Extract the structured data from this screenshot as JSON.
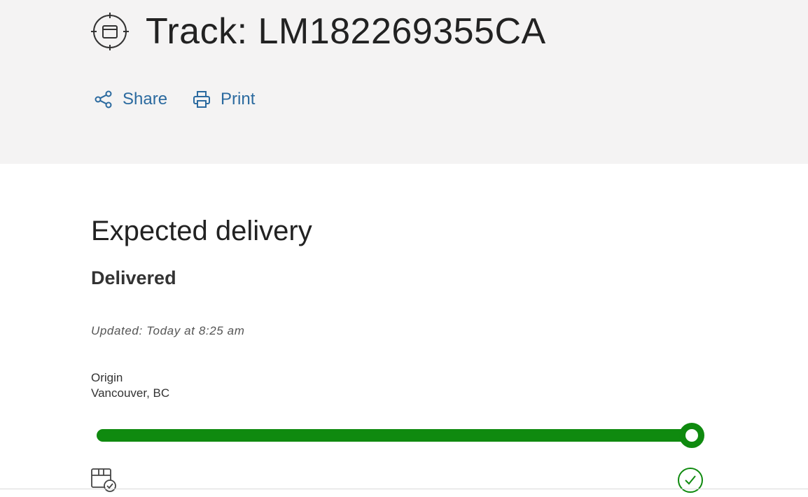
{
  "header": {
    "title": "Track: LM182269355CA",
    "title_icon": "parcel-target-icon",
    "actions": [
      {
        "label": "Share",
        "icon": "share-icon"
      },
      {
        "label": "Print",
        "icon": "printer-icon"
      }
    ]
  },
  "delivery": {
    "section_title": "Expected delivery",
    "status": "Delivered",
    "updated": "Updated: Today at 8:25 am",
    "origin_label": "Origin",
    "origin_value": "Vancouver, BC",
    "progress_fraction": 1.0,
    "start_icon": "package-check-icon",
    "end_icon": "check-circle-icon"
  },
  "colors": {
    "header_bg": "#f4f3f3",
    "link": "#2b6a9f",
    "progress": "#0f8a0f"
  }
}
